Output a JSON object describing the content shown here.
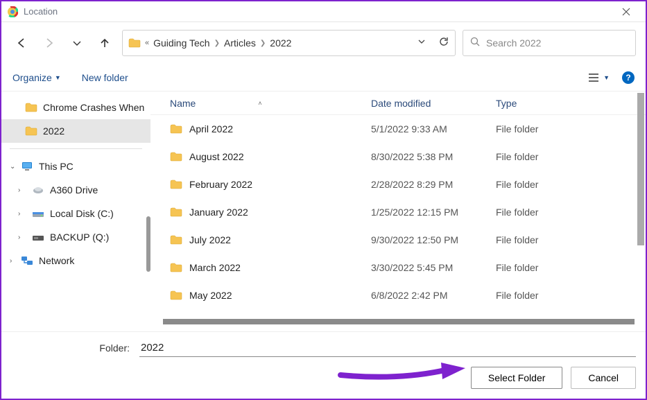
{
  "window": {
    "title": "Location"
  },
  "breadcrumb": {
    "items": [
      "Guiding Tech",
      "Articles",
      "2022"
    ]
  },
  "search": {
    "placeholder": "Search 2022"
  },
  "toolbar": {
    "organize": "Organize",
    "newfolder": "New folder"
  },
  "sidebar": {
    "top": [
      {
        "label": "Chrome Crashes When",
        "icon": "folder"
      },
      {
        "label": "2022",
        "icon": "folder",
        "selected": true
      }
    ],
    "pc": {
      "label": "This PC"
    },
    "drives": [
      {
        "label": "A360 Drive",
        "icon": "cloud"
      },
      {
        "label": "Local Disk (C:)",
        "icon": "disk"
      },
      {
        "label": "BACKUP (Q:)",
        "icon": "disk"
      }
    ],
    "network": {
      "label": "Network"
    }
  },
  "columns": {
    "name": "Name",
    "date": "Date modified",
    "type": "Type"
  },
  "files": [
    {
      "name": "April 2022",
      "date": "5/1/2022 9:33 AM",
      "type": "File folder"
    },
    {
      "name": "August 2022",
      "date": "8/30/2022 5:38 PM",
      "type": "File folder"
    },
    {
      "name": "February 2022",
      "date": "2/28/2022 8:29 PM",
      "type": "File folder"
    },
    {
      "name": "January 2022",
      "date": "1/25/2022 12:15 PM",
      "type": "File folder"
    },
    {
      "name": "July 2022",
      "date": "9/30/2022 12:50 PM",
      "type": "File folder"
    },
    {
      "name": "March 2022",
      "date": "3/30/2022 5:45 PM",
      "type": "File folder"
    },
    {
      "name": "May 2022",
      "date": "6/8/2022 2:42 PM",
      "type": "File folder"
    }
  ],
  "footer": {
    "label": "Folder:",
    "value": "2022",
    "select": "Select Folder",
    "cancel": "Cancel"
  }
}
